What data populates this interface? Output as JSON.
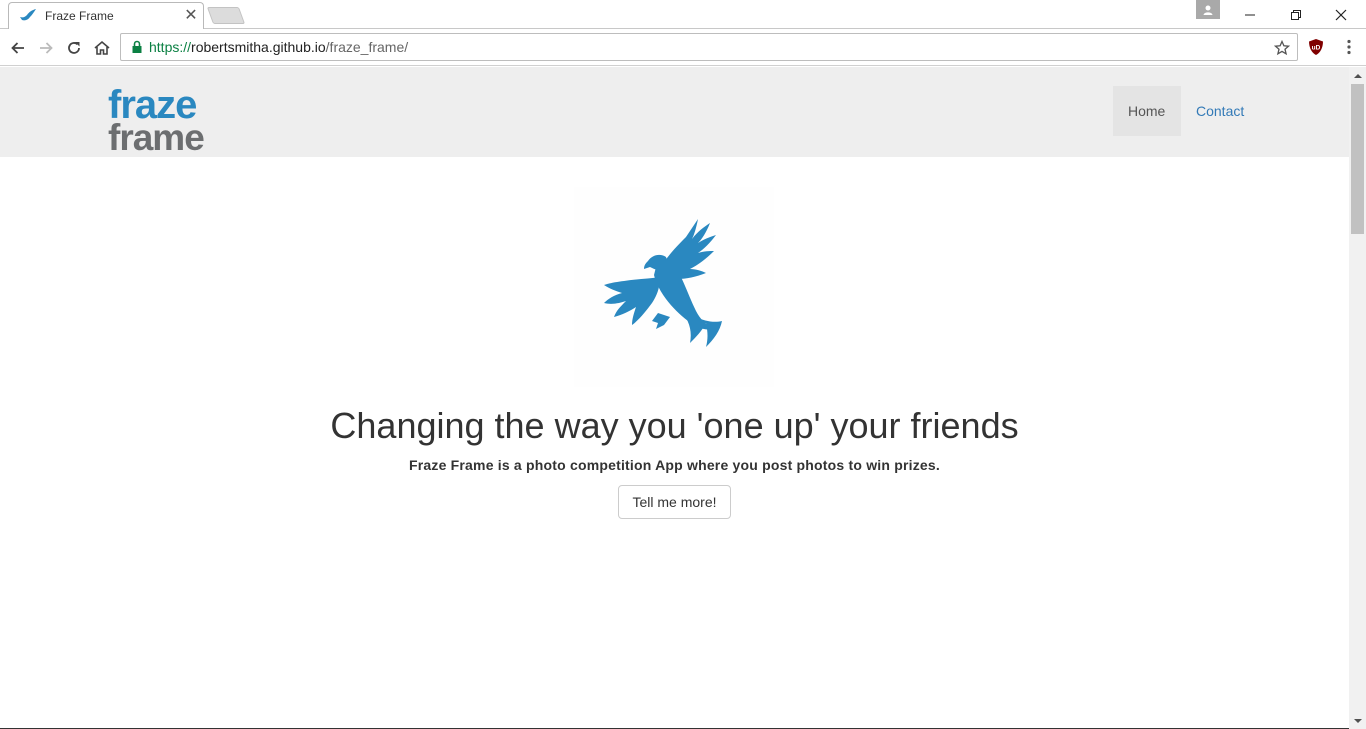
{
  "browser": {
    "tab": {
      "title": "Fraze Frame",
      "close_glyph": "✕"
    },
    "window_controls": {
      "minimize": "—",
      "restore": "❐",
      "close": "✕"
    },
    "url": {
      "scheme": "https://",
      "host": "robertsmitha.github.io",
      "path": "/fraze_frame/"
    },
    "extension_label": "uD"
  },
  "site": {
    "logo": {
      "line1": "fraze",
      "line2": "frame"
    },
    "nav": {
      "home": "Home",
      "contact": "Contact"
    },
    "hero": {
      "headline": "Changing the way you 'one up' your friends",
      "subline": "Fraze Frame is a photo competition App where you post photos to win prizes.",
      "cta": "Tell me more!"
    }
  },
  "colors": {
    "brand_blue": "#2a88c0",
    "brand_gray": "#6c6e70",
    "link": "#337ab7",
    "nav_bg": "#eeeeee",
    "secure_green": "#0b8043"
  },
  "icons": {
    "tab_favicon": "bird-icon",
    "back": "back-arrow-icon",
    "forward": "forward-arrow-icon",
    "reload": "reload-icon",
    "home": "home-icon",
    "lock": "lock-icon",
    "bookmark": "star-icon",
    "extension": "ublock-icon",
    "menu": "kebab-menu-icon",
    "hero": "eagle-icon"
  }
}
